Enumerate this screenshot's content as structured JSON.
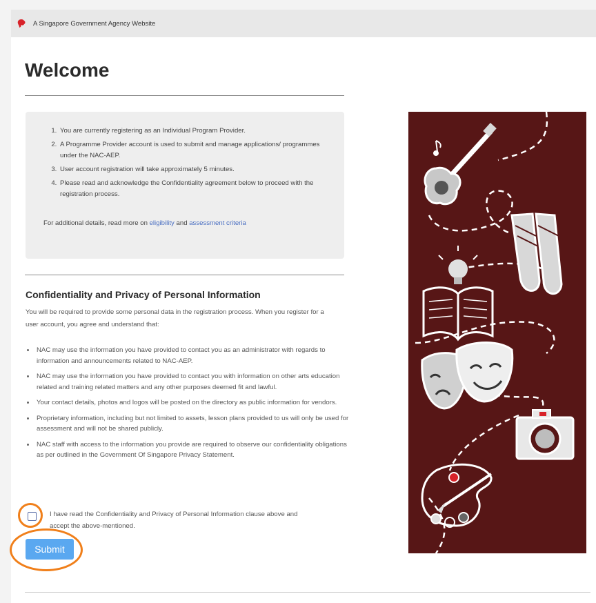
{
  "gov_banner": {
    "text": "A Singapore Government Agency Website",
    "icon": "lion-head-icon"
  },
  "page_title": "Welcome",
  "info_box": {
    "items": [
      "You are currently registering as an Individual Program Provider.",
      "A Programme Provider account is used to submit and manage applications/ programmes under the NAC-AEP.",
      "User account registration will take approximately 5 minutes.",
      "Please read and acknowledge the Confidentiality agreement below to proceed with the registration process."
    ],
    "extra_prefix": "For additional details, read more on ",
    "link_eligibility": "eligibility",
    "extra_and": " and ",
    "link_assessment": "assessment criteria"
  },
  "confidentiality": {
    "heading": "Confidentiality and Privacy of Personal Information",
    "intro": "You will be required to provide some personal data in the registration process. When you register for a user account, you agree and understand that:",
    "bullets": [
      "NAC may use the information you have provided to contact you as an administrator with regards to information and announcements related to NAC-AEP.",
      "NAC may use the information you have provided to contact you with information on other arts education related and training related matters and any other purposes deemed fit and lawful.",
      "Your contact details, photos and logos will be posted on the directory as public information for vendors.",
      "Proprietary information, including but not limited to assets, lesson plans provided to us will only be used for assessment and will not be shared publicly.",
      "NAC staff with access to the information you provide are required to observe our confidentiality obligations as per outlined in the Government Of Singapore Privacy Statement."
    ]
  },
  "consent": {
    "text": "I have read the Confidentiality and Privacy of Personal Information clause above and accept the above-mentioned.",
    "checked": false
  },
  "submit_label": "Submit",
  "colors": {
    "accent": "#5aa8f0",
    "highlight_ring": "#f07f1a",
    "art_background": "#571616",
    "link": "#4a6fc2"
  },
  "art_icons": [
    "guitar-icon",
    "music-note-icon",
    "ballet-shoes-icon",
    "book-icon",
    "lightbulb-icon",
    "theatre-masks-icon",
    "camera-icon",
    "paint-palette-icon"
  ]
}
